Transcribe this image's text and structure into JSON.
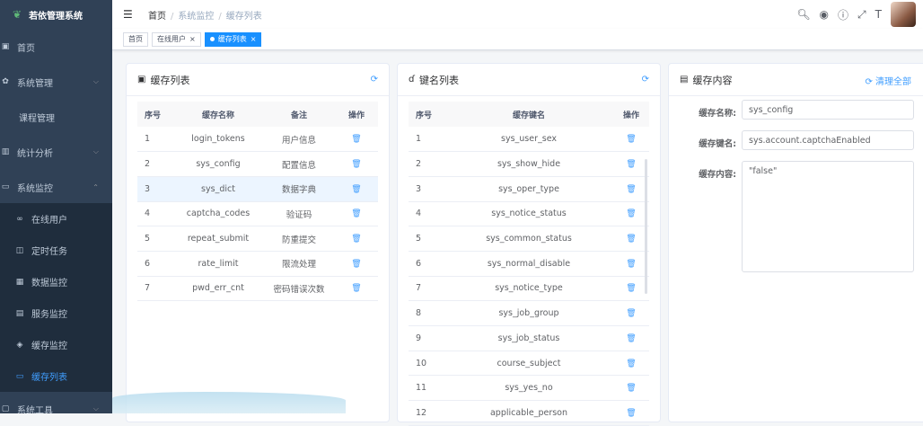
{
  "app": {
    "title": "若依管理系统"
  },
  "sidebar": {
    "items": [
      {
        "label": "首页"
      },
      {
        "label": "系统管理"
      },
      {
        "label": "课程管理"
      },
      {
        "label": "统计分析"
      },
      {
        "label": "系统监控"
      },
      {
        "label": "在线用户"
      },
      {
        "label": "定时任务"
      },
      {
        "label": "数据监控"
      },
      {
        "label": "服务监控"
      },
      {
        "label": "缓存监控"
      },
      {
        "label": "缓存列表"
      },
      {
        "label": "系统工具"
      }
    ]
  },
  "breadcrumb": {
    "home": "首页",
    "parent": "系统监控",
    "current": "缓存列表"
  },
  "tags": {
    "home": "首页",
    "online": "在线用户",
    "cache_list": "缓存列表"
  },
  "cache_list": {
    "title": "缓存列表",
    "headers": {
      "index": "序号",
      "name": "缓存名称",
      "remark": "备注",
      "action": "操作"
    },
    "rows": [
      {
        "index": "1",
        "name": "login_tokens",
        "remark": "用户信息"
      },
      {
        "index": "2",
        "name": "sys_config",
        "remark": "配置信息"
      },
      {
        "index": "3",
        "name": "sys_dict",
        "remark": "数据字典"
      },
      {
        "index": "4",
        "name": "captcha_codes",
        "remark": "验证码"
      },
      {
        "index": "5",
        "name": "repeat_submit",
        "remark": "防重提交"
      },
      {
        "index": "6",
        "name": "rate_limit",
        "remark": "限流处理"
      },
      {
        "index": "7",
        "name": "pwd_err_cnt",
        "remark": "密码错误次数"
      }
    ]
  },
  "key_list": {
    "title": "键名列表",
    "headers": {
      "index": "序号",
      "key": "缓存键名",
      "action": "操作"
    },
    "rows": [
      {
        "index": "1",
        "key": "sys_user_sex"
      },
      {
        "index": "2",
        "key": "sys_show_hide"
      },
      {
        "index": "3",
        "key": "sys_oper_type"
      },
      {
        "index": "4",
        "key": "sys_notice_status"
      },
      {
        "index": "5",
        "key": "sys_common_status"
      },
      {
        "index": "6",
        "key": "sys_normal_disable"
      },
      {
        "index": "7",
        "key": "sys_notice_type"
      },
      {
        "index": "8",
        "key": "sys_job_group"
      },
      {
        "index": "9",
        "key": "sys_job_status"
      },
      {
        "index": "10",
        "key": "course_subject"
      },
      {
        "index": "11",
        "key": "sys_yes_no"
      },
      {
        "index": "12",
        "key": "applicable_person"
      }
    ]
  },
  "cache_content": {
    "title": "缓存内容",
    "clear_all": "清理全部",
    "name_label": "缓存名称:",
    "name_value": "sys_config",
    "key_label": "缓存键名:",
    "key_value": "sys.account.captchaEnabled",
    "content_label": "缓存内容:",
    "content_value": "\"false\""
  },
  "colors": {
    "sidebar_bg": "#304156",
    "accent": "#409eff",
    "active_tag": "#1890ff"
  }
}
